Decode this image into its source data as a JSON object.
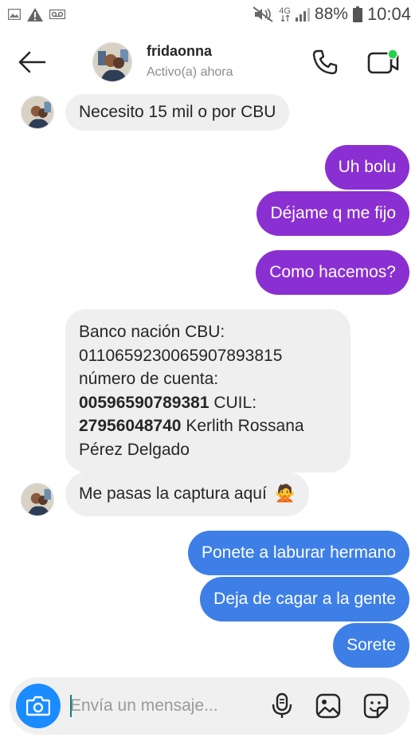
{
  "status_bar": {
    "left_icons": [
      "image-icon",
      "warning-icon",
      "voicemail-icon"
    ],
    "right_icons": [
      "mute-icon",
      "network-4g-icon",
      "signal-icon",
      "battery-icon"
    ],
    "network_label": "4G",
    "battery": "88%",
    "time": "10:04"
  },
  "header": {
    "name": "fridaonna",
    "status": "Activo(a) ahora",
    "icons": [
      "back-arrow-icon",
      "phone-icon",
      "video-call-icon"
    ],
    "online_dot_color": "#1fd34a"
  },
  "messages": [
    {
      "from": "them",
      "text": "Necesito 15 mil o por CBU"
    },
    {
      "from": "me",
      "text": "Uh bolu"
    },
    {
      "from": "me",
      "text": "Déjame q me fijo"
    },
    {
      "from": "me",
      "text": "Como hacemos?"
    },
    {
      "from": "them",
      "lines": [
        {
          "bold": "",
          "text": "Banco nación CBU:"
        },
        {
          "bold": "",
          "text": "0110659230065907893815"
        },
        {
          "bold": "",
          "text": "número de cuenta:"
        },
        {
          "bold": "00596590789381",
          "text": " CUIL:"
        },
        {
          "bold": "27956048740",
          "text": " Kerlith Rossana"
        },
        {
          "bold": "",
          "text": "Pérez Delgado"
        }
      ]
    },
    {
      "from": "them",
      "text": "Me pasas la captura aquí",
      "emoji": "🙅"
    },
    {
      "from": "me",
      "text": "Ponete a laburar hermano"
    },
    {
      "from": "me",
      "text": "Deja de cagar  a la gente"
    },
    {
      "from": "me",
      "text": "Sorete"
    }
  ],
  "composer": {
    "placeholder": "Envía un mensaje...",
    "icons": [
      "camera-icon",
      "microphone-icon",
      "gallery-icon",
      "sticker-icon"
    ]
  },
  "colors": {
    "sent_purple": "#8a2fd2",
    "sent_blue": "#3d7fe6",
    "received_bg": "#efefef",
    "camera_button": "#1a8cff"
  }
}
